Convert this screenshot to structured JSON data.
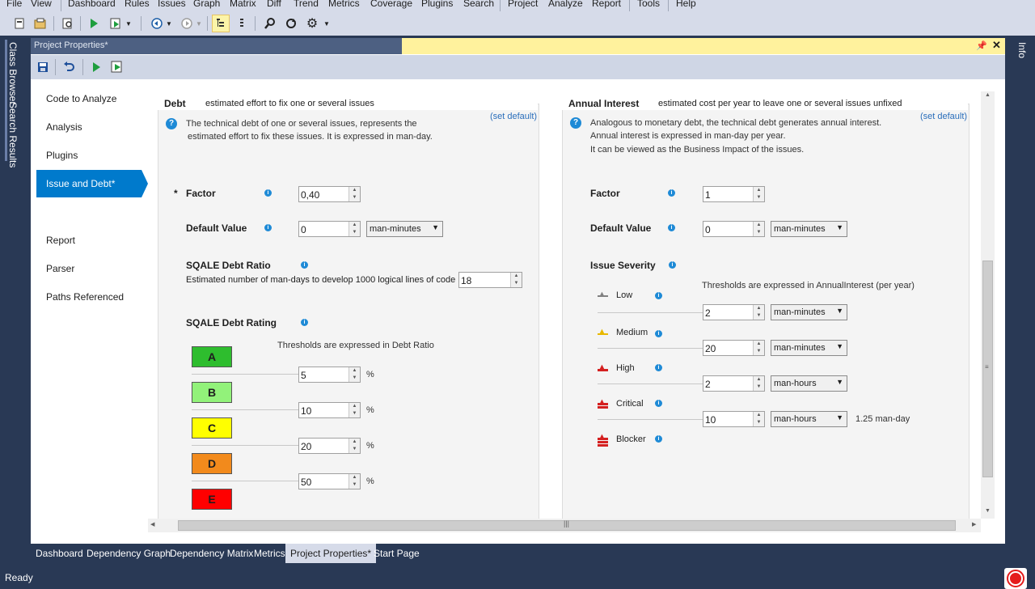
{
  "menu": [
    "File",
    "View",
    "Dashboard",
    "Rules",
    "Issues",
    "Graph",
    "Matrix",
    "Diff",
    "Trend",
    "Metrics",
    "Coverage",
    "Plugins",
    "Search",
    "Project",
    "Analyze",
    "Report",
    "Tools",
    "Help"
  ],
  "left_tabs": [
    "Class Browser",
    "Search Results"
  ],
  "right_tab": "Info",
  "doc_title": "Project Properties*",
  "nav": [
    "Code to Analyze",
    "Analysis",
    "Plugins",
    "Issue and Debt*",
    "Report",
    "Parser",
    "Paths Referenced"
  ],
  "debt": {
    "heading": "Debt",
    "subtitle": "estimated effort to fix one or several issues",
    "set_default": "(set default)",
    "desc1": "The technical debt of one or several issues, represents the",
    "desc2": "estimated effort to fix these issues. It is expressed in man-day.",
    "factor_star": "*",
    "factor_label": "Factor",
    "factor_value": "0,40",
    "default_label": "Default Value",
    "default_value": "0",
    "default_unit": "man-minutes",
    "ratio_label": "SQALE Debt Ratio",
    "ratio_desc": "Estimated number of man-days to develop 1000 logical lines of code",
    "ratio_value": "18",
    "rating_label": "SQALE Debt Rating",
    "thresholds_note": "Thresholds are expressed in Debt Ratio",
    "ratings": [
      {
        "letter": "A",
        "color": "#2ebd2e"
      },
      {
        "letter": "B",
        "color": "#92f27a"
      },
      {
        "letter": "C",
        "color": "#ffff00"
      },
      {
        "letter": "D",
        "color": "#f28a1c"
      },
      {
        "letter": "E",
        "color": "#ff0000"
      }
    ],
    "thresholds": [
      "5",
      "10",
      "20",
      "50"
    ],
    "percent": "%"
  },
  "interest": {
    "heading": "Annual Interest",
    "subtitle": "estimated cost per year to leave one or several issues unfixed",
    "set_default": "(set default)",
    "desc1": "Analogous to monetary debt, the technical debt generates annual interest.",
    "desc2": "Annual interest is expressed in man-day per year.",
    "desc3": "It can be viewed as the Business Impact of the issues.",
    "factor_label": "Factor",
    "factor_value": "1",
    "default_label": "Default Value",
    "default_value": "0",
    "default_unit": "man-minutes",
    "severity_label": "Issue Severity",
    "thresholds_note": "Thresholds are expressed in AnnualInterest (per year)",
    "severities": [
      {
        "name": "Low",
        "color": "#808080"
      },
      {
        "name": "Medium",
        "color": "#e8b800"
      },
      {
        "name": "High",
        "color": "#d42020"
      },
      {
        "name": "Critical",
        "color": "#d42020"
      },
      {
        "name": "Blocker",
        "color": "#d42020"
      }
    ],
    "thresholds": [
      {
        "value": "2",
        "unit": "man-minutes"
      },
      {
        "value": "20",
        "unit": "man-minutes"
      },
      {
        "value": "2",
        "unit": "man-hours"
      },
      {
        "value": "10",
        "unit": "man-hours"
      }
    ],
    "critical_note": "1.25 man-day"
  },
  "bottom_tabs": [
    "Dashboard",
    "Dependency Graph",
    "Dependency Matrix",
    "Metrics",
    "Project Properties*",
    "Start Page"
  ],
  "status": "Ready"
}
